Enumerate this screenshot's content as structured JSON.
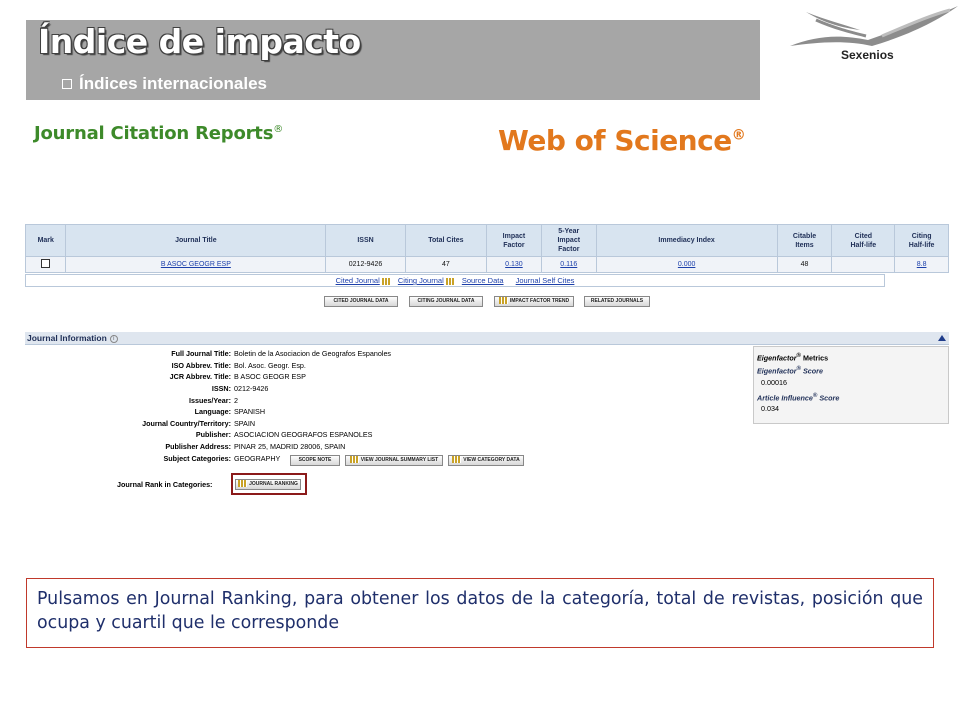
{
  "banner": {
    "title": "Índice de impacto",
    "subtitle": "Índices internacionales"
  },
  "logo": {
    "label": "Sexenios"
  },
  "jcr_logo": {
    "text": "Journal Citation Reports",
    "mark": "®"
  },
  "wos_logo": {
    "text": "Web of Science",
    "mark": "®"
  },
  "table": {
    "headers": [
      "Mark",
      "Journal Title",
      "ISSN",
      "Total Cites",
      "Impact\nFactor",
      "5-Year\nImpact\nFactor",
      "Immediacy Index",
      "Citable\nItems",
      "Cited\nHalf-life",
      "Citing\nHalf-life"
    ],
    "row": {
      "title": "B ASOC GEOGR ESP",
      "issn": "0212-9426",
      "total_cites": "47",
      "impact_factor": "0.130",
      "five_year_if": "0.116",
      "immediacy": "0.000",
      "citable_items": "48",
      "cited_half_life": "",
      "citing_half_life": "8.8"
    }
  },
  "links": {
    "cited_journal": "Cited Journal",
    "citing_journal": "Citing Journal",
    "source_data": "Source Data",
    "self_cites": "Journal Self Cites"
  },
  "buttons": {
    "cited_data": "CITED JOURNAL DATA",
    "citing_data": "CITING JOURNAL DATA",
    "if_trend": "IMPACT FACTOR TREND",
    "related": "RELATED JOURNALS",
    "scope_note": "SCOPE NOTE",
    "summary_list": "VIEW JOURNAL SUMMARY LIST",
    "category_data": "VIEW CATEGORY DATA",
    "journal_ranking": "JOURNAL RANKING"
  },
  "info": {
    "header": "Journal Information",
    "rows": [
      {
        "label": "Full Journal Title:",
        "value": "Boletin de la Asociacion de Geografos Espanoles"
      },
      {
        "label": "ISO Abbrev. Title:",
        "value": "Bol. Asoc. Geogr. Esp."
      },
      {
        "label": "JCR Abbrev. Title:",
        "value": "B ASOC GEOGR ESP"
      },
      {
        "label": "ISSN:",
        "value": "0212-9426"
      },
      {
        "label": "Issues/Year:",
        "value": "2"
      },
      {
        "label": "Language:",
        "value": "SPANISH"
      },
      {
        "label": "Journal Country/Territory:",
        "value": "SPAIN"
      },
      {
        "label": "Publisher:",
        "value": "ASOCIACION GEOGRAFOS ESPANOLES"
      },
      {
        "label": "Publisher Address:",
        "value": "PINAR 25, MADRID 28006, SPAIN"
      },
      {
        "label": "Subject Categories:",
        "value": "GEOGRAPHY"
      }
    ],
    "rank_label": "Journal Rank in Categories:"
  },
  "eigen": {
    "title_a": "Eigenfactor",
    "title_b": " Metrics",
    "score_label_a": "Eigenfactor",
    "score_label_b": " Score",
    "score": "0.00016",
    "ai_label_a": "Article Influence",
    "ai_label_b": " Score",
    "ai": "0.034",
    "reg": "®"
  },
  "caption": "Pulsamos en Journal Ranking, para obtener los datos de la categoría, total de revistas, posición que ocupa y cuartil que le corresponde",
  "colors": {
    "banner": "#a6a6a6",
    "jcr_green": "#3d8a2a",
    "wos_orange": "#e2781d",
    "caption_border": "#c0392b",
    "caption_text": "#1f2f6b"
  }
}
